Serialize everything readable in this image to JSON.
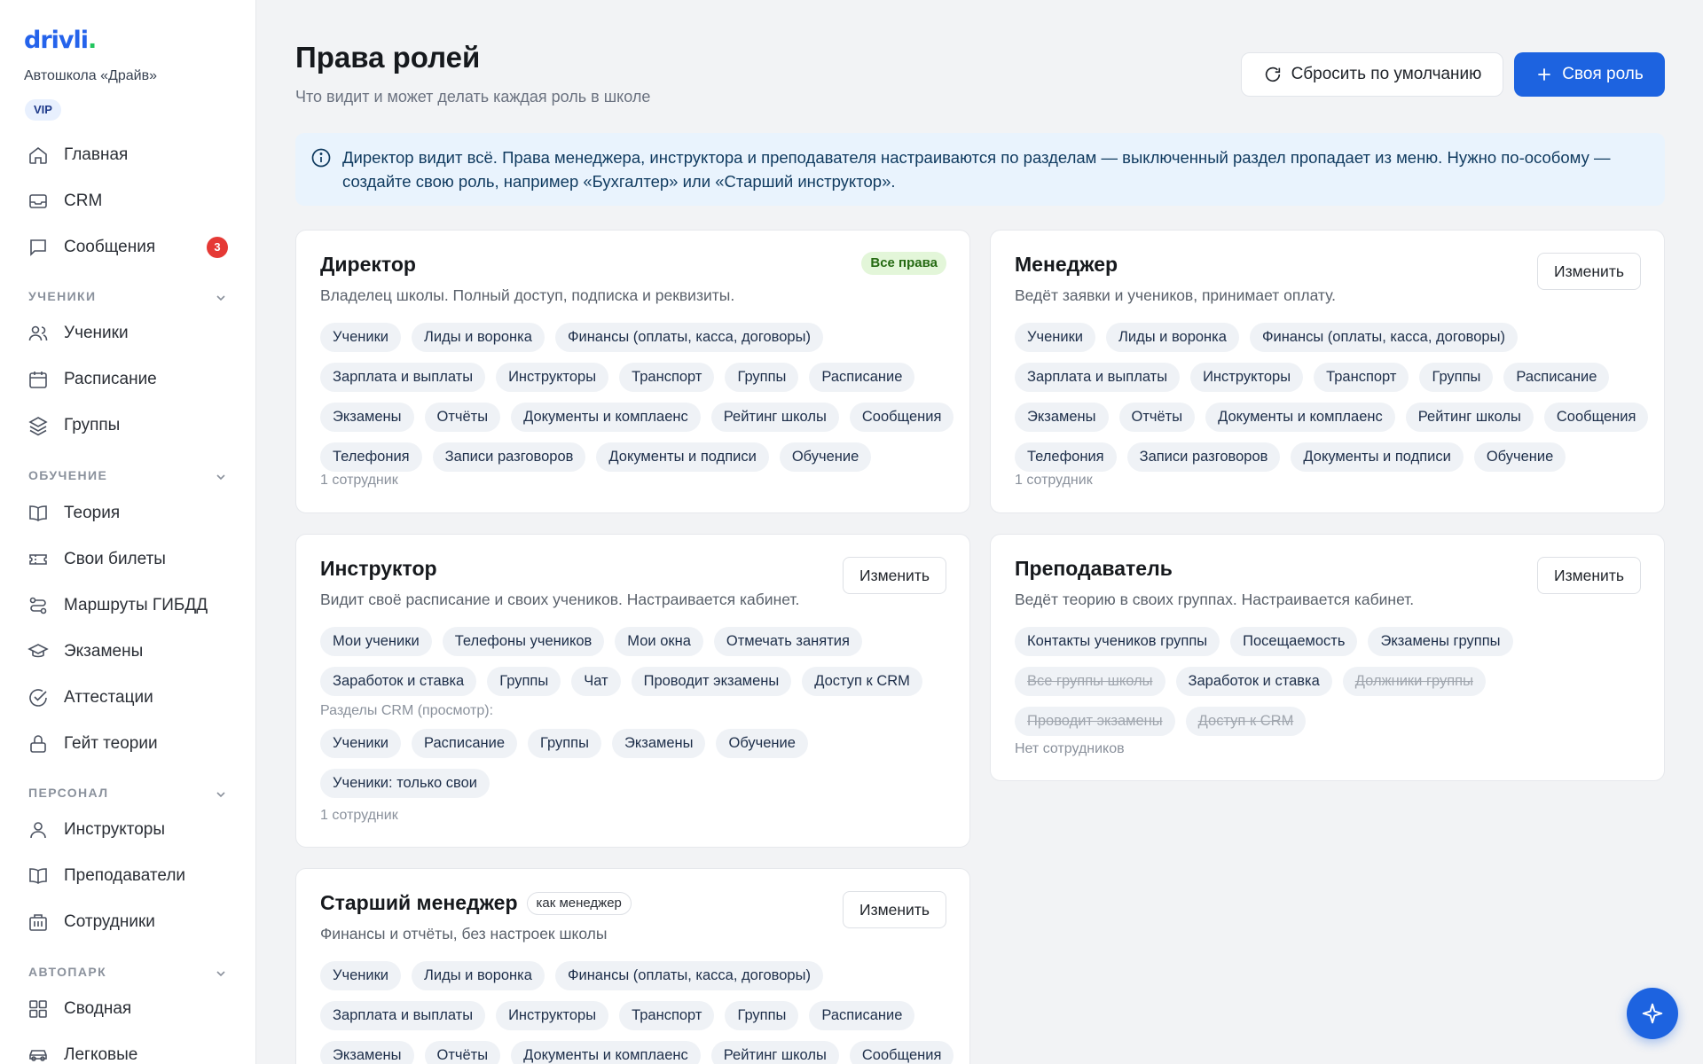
{
  "sidebar": {
    "logo_text": "drivli",
    "logo_dot": ".",
    "school": "Автошкола «Драйв»",
    "vip": "VIP",
    "top_items": [
      {
        "label": "Главная",
        "icon": "home-icon"
      },
      {
        "label": "CRM",
        "icon": "inbox-icon"
      },
      {
        "label": "Сообщения",
        "icon": "chat-icon",
        "badge": "3"
      }
    ],
    "sections": [
      {
        "title": "УЧЕНИКИ",
        "items": [
          {
            "label": "Ученики",
            "icon": "users-icon"
          },
          {
            "label": "Расписание",
            "icon": "calendar-icon"
          },
          {
            "label": "Группы",
            "icon": "layers-icon"
          }
        ]
      },
      {
        "title": "ОБУЧЕНИЕ",
        "items": [
          {
            "label": "Теория",
            "icon": "book-icon"
          },
          {
            "label": "Свои билеты",
            "icon": "ticket-icon"
          },
          {
            "label": "Маршруты ГИБДД",
            "icon": "route-icon"
          },
          {
            "label": "Экзамены",
            "icon": "graduation-cap-icon"
          },
          {
            "label": "Аттестации",
            "icon": "check-circle-icon"
          },
          {
            "label": "Гейт теории",
            "icon": "lock-icon"
          }
        ]
      },
      {
        "title": "ПЕРСОНАЛ",
        "items": [
          {
            "label": "Инструкторы",
            "icon": "user-icon"
          },
          {
            "label": "Преподаватели",
            "icon": "book-open-icon"
          },
          {
            "label": "Сотрудники",
            "icon": "building-icon"
          }
        ]
      },
      {
        "title": "АВТОПАРК",
        "items": [
          {
            "label": "Сводная",
            "icon": "grid-icon"
          },
          {
            "label": "Легковые",
            "icon": "car-icon"
          }
        ]
      }
    ]
  },
  "header": {
    "title": "Права ролей",
    "subtitle": "Что видит и может делать каждая роль в школе",
    "reset_label": "Сбросить по умолчанию",
    "new_role_label": "Своя роль"
  },
  "info": "Директор видит всё. Права менеджера, инструктора и преподавателя настраиваются по разделам — выключенный раздел пропадает из меню. Нужно по-особому — создайте свою роль, например «Бухгалтер» или «Старший инструктор».",
  "roles": {
    "director": {
      "title": "Директор",
      "badge": "Все права",
      "desc": "Владелец школы. Полный доступ, подписка и реквизиты.",
      "chips": [
        "Ученики",
        "Лиды и воронка",
        "Финансы (оплаты, касса, договоры)",
        "Зарплата и выплаты",
        "Инструкторы",
        "Транспорт",
        "Группы",
        "Расписание",
        "Экзамены",
        "Отчёты",
        "Документы и комплаенс",
        "Рейтинг школы",
        "Сообщения",
        "Телефония",
        "Записи разговоров",
        "Документы и подписи",
        "Обучение"
      ],
      "footer": "1 сотрудник"
    },
    "manager": {
      "title": "Менеджер",
      "edit": "Изменить",
      "desc": "Ведёт заявки и учеников, принимает оплату.",
      "chips": [
        "Ученики",
        "Лиды и воронка",
        "Финансы (оплаты, касса, договоры)",
        "Зарплата и выплаты",
        "Инструкторы",
        "Транспорт",
        "Группы",
        "Расписание",
        "Экзамены",
        "Отчёты",
        "Документы и комплаенс",
        "Рейтинг школы",
        "Сообщения",
        "Телефония",
        "Записи разговоров",
        "Документы и подписи",
        "Обучение"
      ],
      "footer": "1 сотрудник"
    },
    "instructor": {
      "title": "Инструктор",
      "edit": "Изменить",
      "desc": "Видит своё расписание и своих учеников. Настраивается кабинет.",
      "chips": [
        "Мои ученики",
        "Телефоны учеников",
        "Мои окна",
        "Отмечать занятия",
        "Заработок и ставка",
        "Группы",
        "Чат",
        "Проводит экзамены",
        "Доступ к CRM"
      ],
      "crm_label": "Разделы CRM (просмотр):",
      "crm_chips": [
        "Ученики",
        "Расписание",
        "Группы",
        "Экзамены",
        "Обучение",
        "Ученики: только свои"
      ],
      "footer": "1 сотрудник"
    },
    "teacher": {
      "title": "Преподаватель",
      "edit": "Изменить",
      "desc": "Ведёт теорию в своих группах. Настраивается кабинет.",
      "chips": [
        {
          "label": "Контакты учеников группы",
          "enabled": true
        },
        {
          "label": "Посещаемость",
          "enabled": true
        },
        {
          "label": "Экзамены группы",
          "enabled": true
        },
        {
          "label": "Все группы школы",
          "enabled": false
        },
        {
          "label": "Заработок и ставка",
          "enabled": true
        },
        {
          "label": "Должники группы",
          "enabled": false
        },
        {
          "label": "Проводит экзамены",
          "enabled": false
        },
        {
          "label": "Доступ к CRM",
          "enabled": false
        }
      ],
      "footer": "Нет сотрудников"
    },
    "senior_manager": {
      "title": "Старший менеджер",
      "tag": "как менеджер",
      "edit": "Изменить",
      "desc": "Финансы и отчёты, без настроек школы",
      "chips": [
        "Ученики",
        "Лиды и воронка",
        "Финансы (оплаты, касса, договоры)",
        "Зарплата и выплаты",
        "Инструкторы",
        "Транспорт",
        "Группы",
        "Расписание",
        "Экзамены",
        "Отчёты",
        "Документы и комплаенс",
        "Рейтинг школы",
        "Сообщения"
      ]
    }
  },
  "fab_icon": "sparkle-icon",
  "colors": {
    "accent": "#1d63e0",
    "badge_red": "#e53935",
    "info_bg": "#e9f3fd",
    "all_rights_bg": "#e3f6d9"
  }
}
